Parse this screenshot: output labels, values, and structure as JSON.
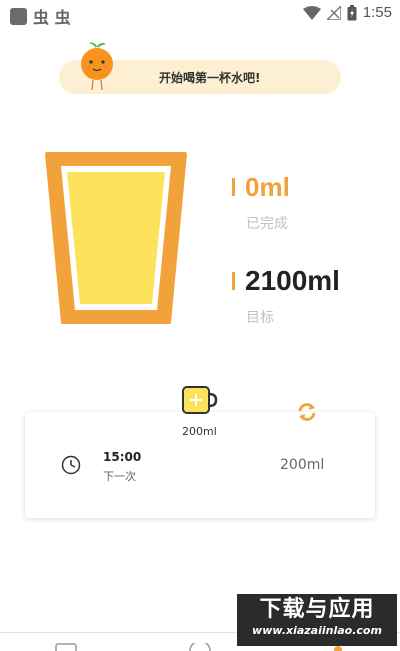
{
  "status_bar": {
    "app_glyphs": "虫 虫",
    "time": "1:55",
    "icons": [
      "wifi-icon",
      "signal-off-icon",
      "battery-charging-icon"
    ]
  },
  "banner": {
    "text": "开始喝第一杯水吧!",
    "mascot": "orange-mascot"
  },
  "progress": {
    "completed_value": "0ml",
    "completed_label": "已完成",
    "target_value": "2100ml",
    "target_label": "目标",
    "fill_fraction": 0.0
  },
  "cup_colors": {
    "border": "#f2a23a",
    "inner": "#ffffff",
    "water": "#fde35c"
  },
  "drink_button": {
    "amount_label": "200ml",
    "icon": "mug-plus-icon"
  },
  "reminder": {
    "time": "15:00",
    "label": "下一次",
    "amount": "200ml",
    "icons": [
      "clock-icon",
      "refresh-icon"
    ]
  },
  "watermark": {
    "main": "下载与应用",
    "url": "www.xiazaiinlao.com"
  },
  "colors": {
    "accent": "#f2a23a",
    "banner_bg": "#fdf0d2",
    "muted_text": "#c2c2c2"
  }
}
